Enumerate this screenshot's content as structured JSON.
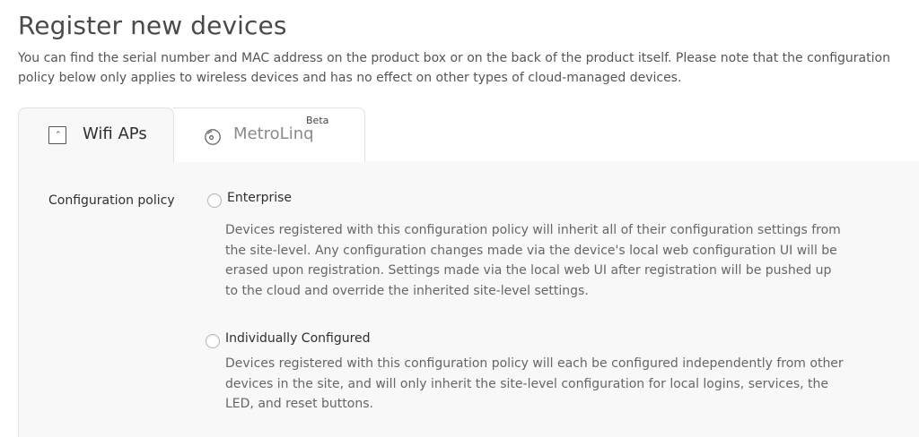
{
  "page": {
    "title": "Register new devices",
    "intro": "You can find the serial number and MAC address on the product box or on the back of the product itself. Please note that the configuration policy below only applies to wireless devices and has no effect on other types of cloud-managed devices."
  },
  "tabs": [
    {
      "label": "Wifi APs",
      "icon": "access-point-icon",
      "active": true
    },
    {
      "label": "MetroLinq",
      "icon": "metrolinq-radio-icon",
      "badge": "Beta",
      "active": false
    }
  ],
  "form": {
    "config_policy_label": "Configuration policy",
    "options": [
      {
        "label": "Enterprise",
        "selected": false,
        "description": "Devices registered with this configuration policy will inherit all of their configuration settings from the site-level. Any configuration changes made via the device's local web configuration UI will be erased upon registration. Settings made via the local web UI after registration will be pushed up to the cloud and override the inherited site-level settings."
      },
      {
        "label": "Individually Configured",
        "selected": false,
        "description": "Devices registered with this configuration policy will each be configured independently from other devices in the site, and will only inherit the site-level configuration for local logins, services, the LED, and reset buttons."
      }
    ]
  },
  "colors": {
    "text_primary": "#2f2f2f",
    "text_secondary": "#666666",
    "panel_background": "#f8f8f8",
    "border": "#e2e2e2"
  }
}
